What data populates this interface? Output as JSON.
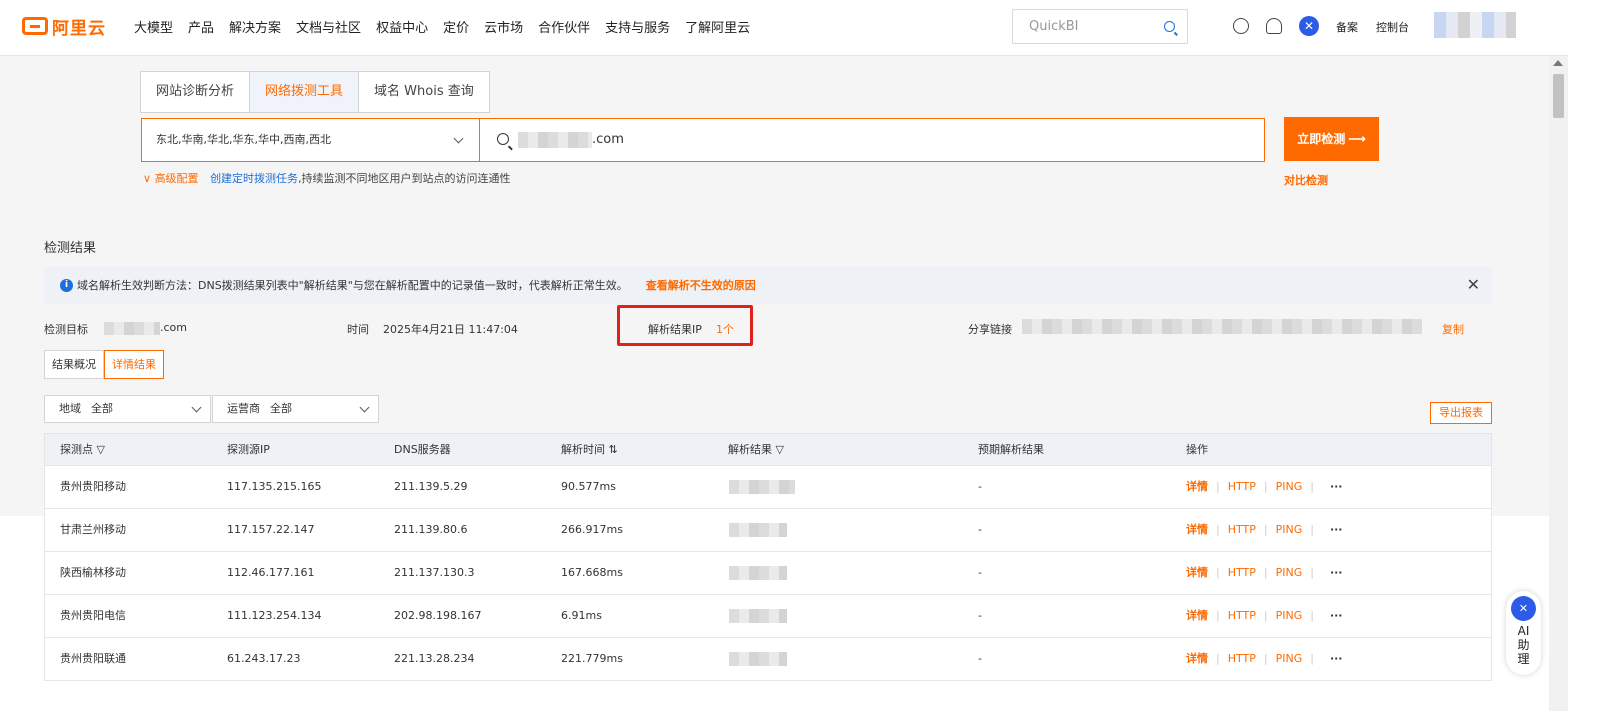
{
  "brand": {
    "name": "阿里云",
    "color": "#ff6a00"
  },
  "nav": [
    "大模型",
    "产品",
    "解决方案",
    "文档与社区",
    "权益中心",
    "定价",
    "云市场",
    "合作伙伴",
    "支持与服务",
    "了解阿里云"
  ],
  "search": {
    "placeholder": "QuickBI"
  },
  "top_links": {
    "beian": "备案",
    "console": "控制台"
  },
  "tool_tabs": [
    {
      "label": "网站诊断分析",
      "active": false
    },
    {
      "label": "网络拨测工具",
      "active": true
    },
    {
      "label": "域名 Whois 查询",
      "active": false
    }
  ],
  "probe": {
    "regions": "东北,华南,华北,华东,华中,西南,西北",
    "domain_suffix": ".com",
    "button": "立即检测 ⟶",
    "advanced": "高级配置",
    "create_task": "创建定时拨测任务",
    "create_task_desc": ",持续监测不同地区用户到站点的访问连通性",
    "compare": "对比检测"
  },
  "results": {
    "title": "检测结果",
    "info": "域名解析生效判断方法：DNS拨测结果列表中\"解析结果\"与您在解析配置中的记录值一致时，代表解析正常生效。",
    "info_link": "查看解析不生效的原因",
    "target_label": "检测目标",
    "target_suffix": ".com",
    "time_label": "时间",
    "time_value": "2025年4月21日 11:47:04",
    "ip_label": "解析结果IP",
    "ip_count": "1个",
    "share_label": "分享链接",
    "copy": "复制",
    "view_tabs": [
      "结果概况",
      "详情结果"
    ],
    "filters": [
      {
        "label": "地域",
        "value": "全部"
      },
      {
        "label": "运营商",
        "value": "全部"
      }
    ],
    "export": "导出报表"
  },
  "table": {
    "headers": [
      "探测点",
      "探测源IP",
      "DNS服务器",
      "解析时间",
      "解析结果",
      "预期解析结果",
      "操作"
    ],
    "rows": [
      {
        "point": "贵州贵阳移动",
        "src_ip": "117.135.215.165",
        "dns": "211.139.5.29",
        "time": "90.577ms",
        "expected": "-"
      },
      {
        "point": "甘肃兰州移动",
        "src_ip": "117.157.22.147",
        "dns": "211.139.80.6",
        "time": "266.917ms",
        "expected": "-"
      },
      {
        "point": "陕西榆林移动",
        "src_ip": "112.46.177.161",
        "dns": "211.137.130.3",
        "time": "167.668ms",
        "expected": "-"
      },
      {
        "point": "贵州贵阳电信",
        "src_ip": "111.123.254.134",
        "dns": "202.98.198.167",
        "time": "6.91ms",
        "expected": "-"
      },
      {
        "point": "贵州贵阳联通",
        "src_ip": "61.243.17.23",
        "dns": "221.13.28.234",
        "time": "221.779ms",
        "expected": "-"
      }
    ],
    "actions": [
      "详情",
      "HTTP",
      "PING",
      "···"
    ]
  },
  "ai_helper": {
    "label": "AI",
    "line2": "助",
    "line3": "理"
  }
}
